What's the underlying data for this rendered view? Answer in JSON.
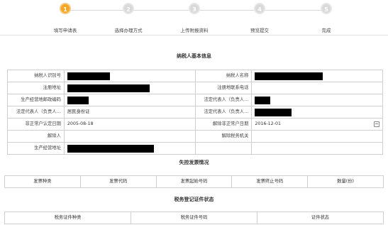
{
  "steps": [
    {
      "number": "1",
      "label": "填写申请表",
      "active": true
    },
    {
      "number": "2",
      "label": "选择办理方式",
      "active": false
    },
    {
      "number": "3",
      "label": "上传附报资料",
      "active": false
    },
    {
      "number": "4",
      "label": "预览提交",
      "active": false
    },
    {
      "number": "5",
      "label": "完成",
      "active": false
    }
  ],
  "basic_info": {
    "title": "纳税人基本信息",
    "rows": [
      {
        "l1": "纳税人识别号",
        "v1": "",
        "l2": "纳税人名称",
        "v2": ""
      },
      {
        "l1": "注册地址",
        "v1": "",
        "l2": "注册地联系电话",
        "v2": ""
      },
      {
        "l1": "生产经营地邮政编码",
        "v1": "",
        "l2": "法定代表人（负责人…",
        "v2": ""
      },
      {
        "l1": "法定代表人（负责人…",
        "v1": "居民身份证",
        "l2": "法定代表人（负责人…",
        "v2": ""
      },
      {
        "l1": "非正常户认定日期",
        "v1": "2005-08-18",
        "l2": "解除非正常户日期",
        "v2": "2016-12-01"
      },
      {
        "l1": "解除人",
        "v1": "",
        "l2": "解除税务机关",
        "v2": ""
      },
      {
        "l1": "生产经营地址",
        "v1": "",
        "l2": "",
        "v2": ""
      }
    ]
  },
  "invoice": {
    "title": "失控发票情况",
    "headers": [
      "发票种类",
      "发票代码",
      "发票起始号码",
      "发票终止号码",
      "数量(份)"
    ]
  },
  "cert": {
    "title": "税务登记证件状态",
    "headers": [
      "税务证件种类",
      "税务证件号码",
      "证件状态"
    ]
  }
}
